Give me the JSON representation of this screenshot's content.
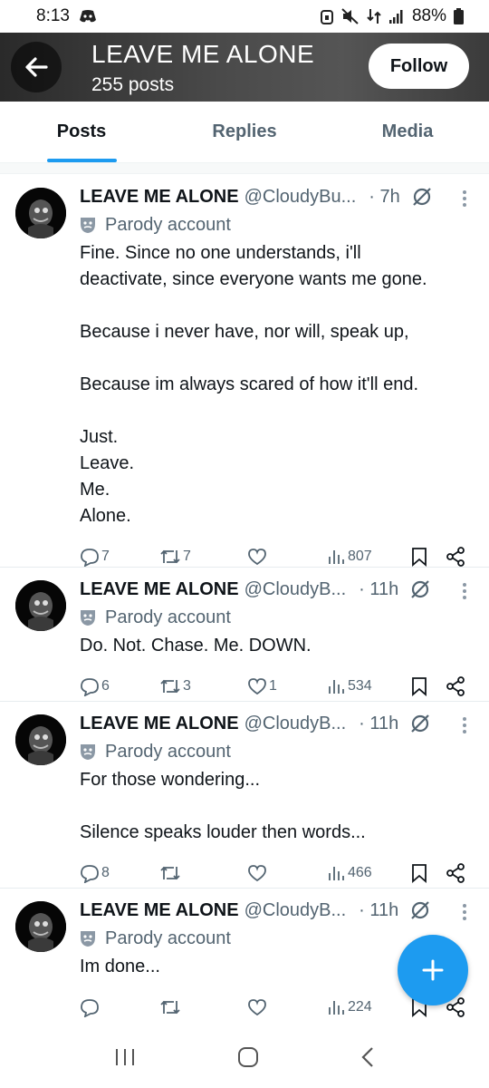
{
  "status_bar": {
    "time": "8:13",
    "battery": "88%"
  },
  "header": {
    "title": "LEAVE ME ALONE",
    "post_count": "255 posts",
    "follow_label": "Follow"
  },
  "tabs": [
    {
      "label": "Posts",
      "active": true
    },
    {
      "label": "Replies",
      "active": false
    },
    {
      "label": "Media",
      "active": false
    }
  ],
  "posts": [
    {
      "name": "LEAVE ME ALONE",
      "handle": "@CloudyBu...",
      "time": "· 7h",
      "parody_label": "Parody account",
      "lines": [
        "Fine. Since no one understands, i'll",
        "deactivate, since everyone wants me gone.",
        "",
        "Because i never have, nor will, speak up,",
        "",
        "Because im always scared of how it'll end.",
        "",
        "Just.",
        "Leave.",
        "Me.",
        "Alone."
      ],
      "replies": "7",
      "reposts": "7",
      "likes": "",
      "views": "807"
    },
    {
      "name": "LEAVE ME ALONE",
      "handle": "@CloudyB...",
      "time": "· 11h",
      "parody_label": "Parody account",
      "lines": [
        "Do. Not. Chase. Me. DOWN."
      ],
      "replies": "6",
      "reposts": "3",
      "likes": "1",
      "views": "534"
    },
    {
      "name": "LEAVE ME ALONE",
      "handle": "@CloudyB...",
      "time": "· 11h",
      "parody_label": "Parody account",
      "lines": [
        "For those wondering...",
        "",
        "Silence speaks louder then words..."
      ],
      "replies": "8",
      "reposts": "",
      "likes": "",
      "views": "466"
    },
    {
      "name": "LEAVE ME ALONE",
      "handle": "@CloudyB...",
      "time": "· 11h",
      "parody_label": "Parody account",
      "lines": [
        "Im done..."
      ],
      "replies": "",
      "reposts": "",
      "likes": "",
      "views": "224"
    }
  ],
  "colors": {
    "accent": "#1d9bf0",
    "text": "#0f1419",
    "muted": "#536471"
  }
}
